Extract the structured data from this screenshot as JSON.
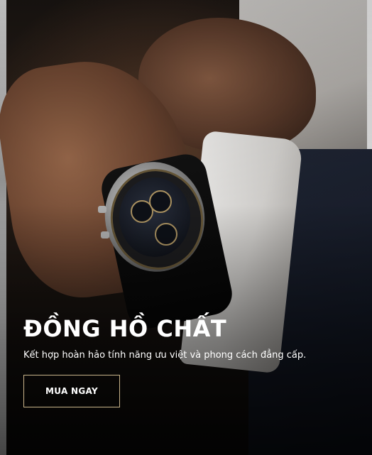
{
  "hero": {
    "title": "ĐỒNG HỒ CHẤT",
    "subtitle": "Kết hợp hoàn hảo tính năng ưu việt và phong cách đẳng cấp.",
    "cta_label": "MUA NGAY"
  },
  "colors": {
    "cta_border": "#c9b48a",
    "text": "#ffffff",
    "background": "#0b0b0d"
  }
}
